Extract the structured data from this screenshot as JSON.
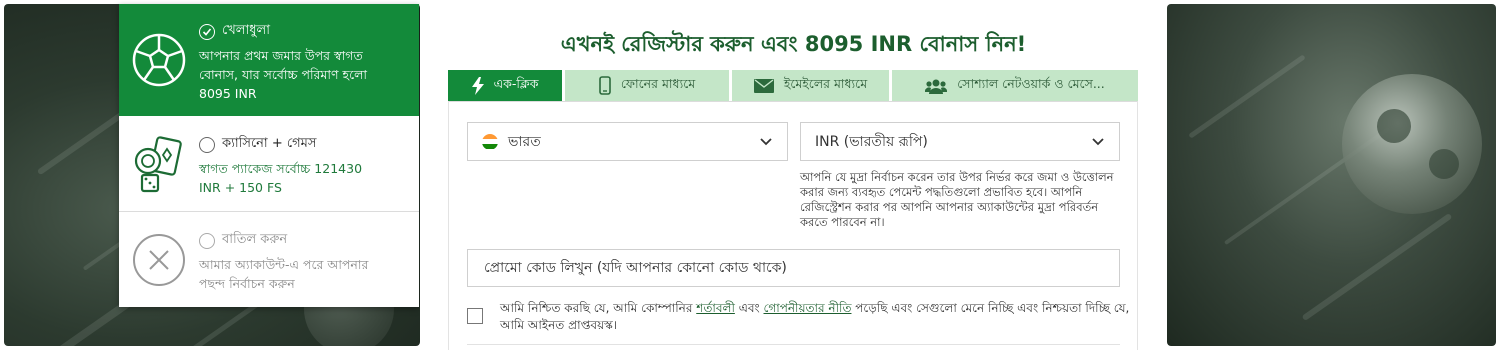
{
  "heading": "এখনই রেজিস্টার করুন এবং 8095 INR বোনাস নিন!",
  "bonus_options": [
    {
      "title": "খেলাধুলা",
      "desc_lines": [
        "আপনার প্রথম জমার উপর স্বাগত",
        "বোনাস, যার সর্বোচ্চ পরিমাণ হলো",
        "8095 INR"
      ],
      "icon": "soccer-ball-icon",
      "selected": true
    },
    {
      "title": "ক্যাসিনো + গেমস",
      "desc_lines": [
        "স্বাগত প্যাকেজ সর্বোচ্চ 121430",
        "INR + 150 FS"
      ],
      "icon": "casino-chips-cards-icon",
      "selected": false
    },
    {
      "title": "বাতিল করুন",
      "desc_lines": [
        "আমার অ্যাকাউন্ট-এ পরে আপনার",
        "পছন্দ নির্বাচন করুন"
      ],
      "icon": "cancel-x-icon",
      "selected": false
    }
  ],
  "tabs": [
    {
      "label": "এক-ক্লিক",
      "icon": "lightning-icon",
      "active": true
    },
    {
      "label": "ফোনের মাধ্যমে",
      "icon": "phone-icon",
      "active": false
    },
    {
      "label": "ইমেইলের মাধ্যমে",
      "icon": "envelope-icon",
      "active": false
    },
    {
      "label": "সোশ্যাল নেটওয়ার্ক ও মেসে...",
      "icon": "users-icon",
      "active": false
    }
  ],
  "country_select": {
    "value": "ভারত",
    "icon": "india-flag-icon"
  },
  "currency_select": {
    "value": "INR (ভারতীয় রূপি)"
  },
  "currency_help_lines": [
    "আপনি যে মুদ্রা নির্বাচন করেন তার উপর নির্ভর করে জমা ও উত্তোলন",
    "করার জন্য ব্যবহৃত পেমেন্ট পদ্ধতিগুলো প্রভাবিত হবে। আপনি",
    "রেজিস্ট্রেশন করার পর আপনি আপনার অ্যাকাউন্টের মুদ্রা পরিবর্তন",
    "করতে পারবেন না।"
  ],
  "promo_placeholder": "প্রোমো কোড লিখুন (যদি আপনার কোনো কোড থাকে)",
  "terms": {
    "part1": "আমি নিশ্চিত করছি যে, আমি কোম্পানির ",
    "link1": "শর্তাবলী",
    "part2": " এবং ",
    "link2": "গোপনীয়তার নীতি",
    "part3": " পড়েছি এবং সেগুলো মেনে নিচ্ছি এবং নিশ্চয়তা দিচ্ছি যে,",
    "line2": "আমি আইনত প্রাপ্তবয়স্ক।"
  },
  "colors": {
    "brand_green": "#138a3a",
    "tab_inactive": "#c4e6c8",
    "heading": "#1c5e2e"
  }
}
